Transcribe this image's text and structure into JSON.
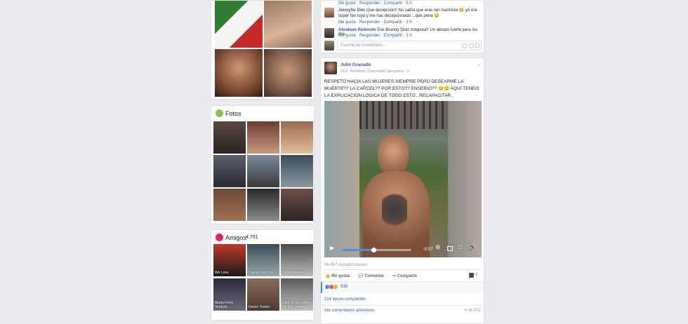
{
  "comments_top": [
    {
      "author": "",
      "text": "",
      "actions": "Me gusta · Responder · Compartir · 5 h"
    },
    {
      "author": "Jennyfer Dier",
      "text": "Que decepción!! No sabía que eras tan machista 😒 yo era súper fan tuya y me has decepcionado ...que pena 😒",
      "actions": "Me gusta · Responder · Compartir · 3 h"
    },
    {
      "author": "Abraham Redondo",
      "text": "Ese Brandy Sturt máquina!! Un abrazo fuerte para los dos",
      "actions": "Me gusta · Responder · Compartir · 1 h"
    }
  ],
  "comment_input": {
    "placeholder": "Escribe un comentario..."
  },
  "fotos": {
    "title": "Fotos"
  },
  "amigos": {
    "title": "Amigos",
    "count": "4.791",
    "friends": [
      {
        "name": "We Love"
      },
      {
        "name": "Cabuky Sancho"
      },
      {
        "name": "Omar Morales"
      },
      {
        "name": "Marta Ferré Ventura"
      },
      {
        "name": "Daniel Teodor"
      },
      {
        "name": "Dani De la Fuente De la Fuente"
      }
    ]
  },
  "post": {
    "author": "Julio Granado",
    "meta": "10 h · Benidorm, Comunidad Valenciana · ⊙",
    "text": "RESPETO HACIA LAS MUJERES SIEMPRE PERO DESEARME LA MUERTE?? LA CARCEL?? POR ESTO?? ENSERIO?? 😒😒 AQUI TENEIS LA EXPLICACION LOGICA DE TODO ESTO...RECAPACITAR..",
    "video": {
      "time": "-0:57",
      "progress": 0.45
    },
    "views": "56.457 reproducciones",
    "actions": {
      "like": "Me gusta",
      "comment": "Comentar",
      "share": "Compartir"
    },
    "reactions_count": "938",
    "shares": "224 veces compartido",
    "prev_comments": "Ver comentarios anteriores",
    "pagination": "4 de 502"
  },
  "colors": {
    "link": "#365899",
    "bg": "#e9ebee",
    "fotos_icon": "#8bc34a",
    "amigos_icon": "#e91e63",
    "progress": "#4a90e2"
  }
}
